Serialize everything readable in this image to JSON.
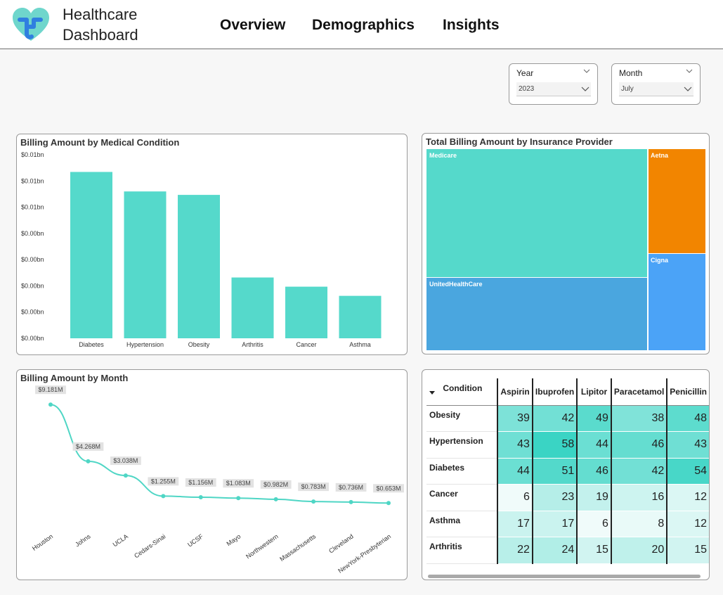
{
  "app": {
    "title_line1": "Healthcare",
    "title_line2": "Dashboard"
  },
  "nav": [
    {
      "label": "Overview"
    },
    {
      "label": "Demographics"
    },
    {
      "label": "Insights"
    }
  ],
  "filters": {
    "year": {
      "label": "Year",
      "value": "2023"
    },
    "month": {
      "label": "Month",
      "value": "July"
    }
  },
  "colors": {
    "accent": "#55d9cb",
    "aetna": "#f28500",
    "unitedhealthcare": "#4aa6df",
    "cigna": "#4ba3f7"
  },
  "chart_data": [
    {
      "type": "bar",
      "title": "Billing Amount by Medical Condition",
      "categories": [
        "Diabetes",
        "Hypertension",
        "Obesity",
        "Arthritis",
        "Cancer",
        "Asthma"
      ],
      "values": [
        0.0145,
        0.0128,
        0.0125,
        0.0053,
        0.0045,
        0.0037
      ],
      "y_tick_labels": [
        "$0.01bn",
        "$0.01bn",
        "$0.01bn",
        "$0.00bn",
        "$0.00bn",
        "$0.00bn",
        "$0.00bn",
        "$0.00bn"
      ],
      "ylim": [
        0,
        0.016
      ],
      "color": "#55d9cb"
    },
    {
      "type": "treemap",
      "title": "Total Billing Amount by Insurance Provider",
      "items": [
        {
          "name": "Medicare",
          "color": "#55d9cb"
        },
        {
          "name": "UnitedHealthCare",
          "color": "#4aa6df"
        },
        {
          "name": "Aetna",
          "color": "#f28500"
        },
        {
          "name": "Cigna",
          "color": "#4ba3f7"
        }
      ]
    },
    {
      "type": "line",
      "title": "Billing Amount by Month",
      "categories": [
        "Houston",
        "Johns",
        "UCLA",
        "Cedars-Sinai",
        "UCSF",
        "Mayo",
        "Northwestern",
        "Massachusetts",
        "Cleveland",
        "NewYork-Presbyterian"
      ],
      "values": [
        9.181,
        4.268,
        3.038,
        1.255,
        1.156,
        1.083,
        0.982,
        0.783,
        0.736,
        0.653
      ],
      "data_labels": [
        "$9.181M",
        "$4.268M",
        "$3.038M",
        "$1.255M",
        "$1.156M",
        "$1.083M",
        "$0.982M",
        "$0.783M",
        "$0.736M",
        "$0.653M"
      ],
      "ylim": [
        0,
        9.5
      ],
      "color": "#4fd6c5"
    },
    {
      "type": "table",
      "row_header": "Condition",
      "columns": [
        "Aspirin",
        "Ibuprofen",
        "Lipitor",
        "Paracetamol",
        "Penicillin"
      ],
      "rows": [
        {
          "label": "Obesity",
          "values": [
            39,
            42,
            49,
            38,
            48
          ]
        },
        {
          "label": "Hypertension",
          "values": [
            43,
            58,
            44,
            46,
            43
          ]
        },
        {
          "label": "Diabetes",
          "values": [
            44,
            51,
            46,
            42,
            54
          ]
        },
        {
          "label": "Cancer",
          "values": [
            6,
            23,
            19,
            16,
            12
          ]
        },
        {
          "label": "Asthma",
          "values": [
            17,
            17,
            6,
            8,
            12
          ]
        },
        {
          "label": "Arthritis",
          "values": [
            22,
            24,
            15,
            20,
            15
          ]
        }
      ],
      "value_range": [
        6,
        58
      ]
    }
  ]
}
